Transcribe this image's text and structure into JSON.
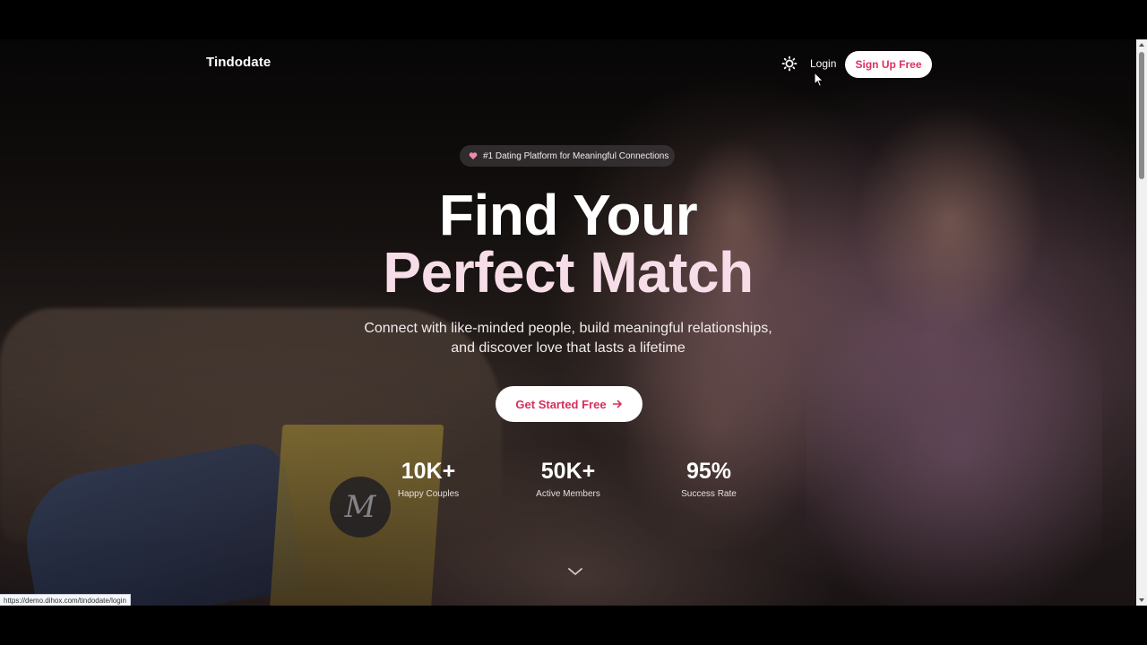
{
  "nav": {
    "brand": "Tindodate",
    "login_label": "Login",
    "signup_label": "Sign Up Free",
    "theme_icon": "sun-icon"
  },
  "hero": {
    "badge_text": "#1 Dating Platform for Meaningful Connections",
    "title_line1": "Find Your",
    "title_line2": "Perfect Match",
    "subtitle_line1": "Connect with like-minded people, build meaningful relationships,",
    "subtitle_line2": "and discover love that lasts a lifetime",
    "cta_label": "Get Started Free"
  },
  "stats": [
    {
      "value": "10K+",
      "label": "Happy Couples"
    },
    {
      "value": "50K+",
      "label": "Active Members"
    },
    {
      "value": "95%",
      "label": "Success Rate"
    }
  ],
  "status_bar": {
    "url": "https://demo.dihox.com/tindodate/login"
  },
  "colors": {
    "accent": "#e0305f",
    "title_highlight": "#f6dde7",
    "heart": "#f08aa8"
  }
}
